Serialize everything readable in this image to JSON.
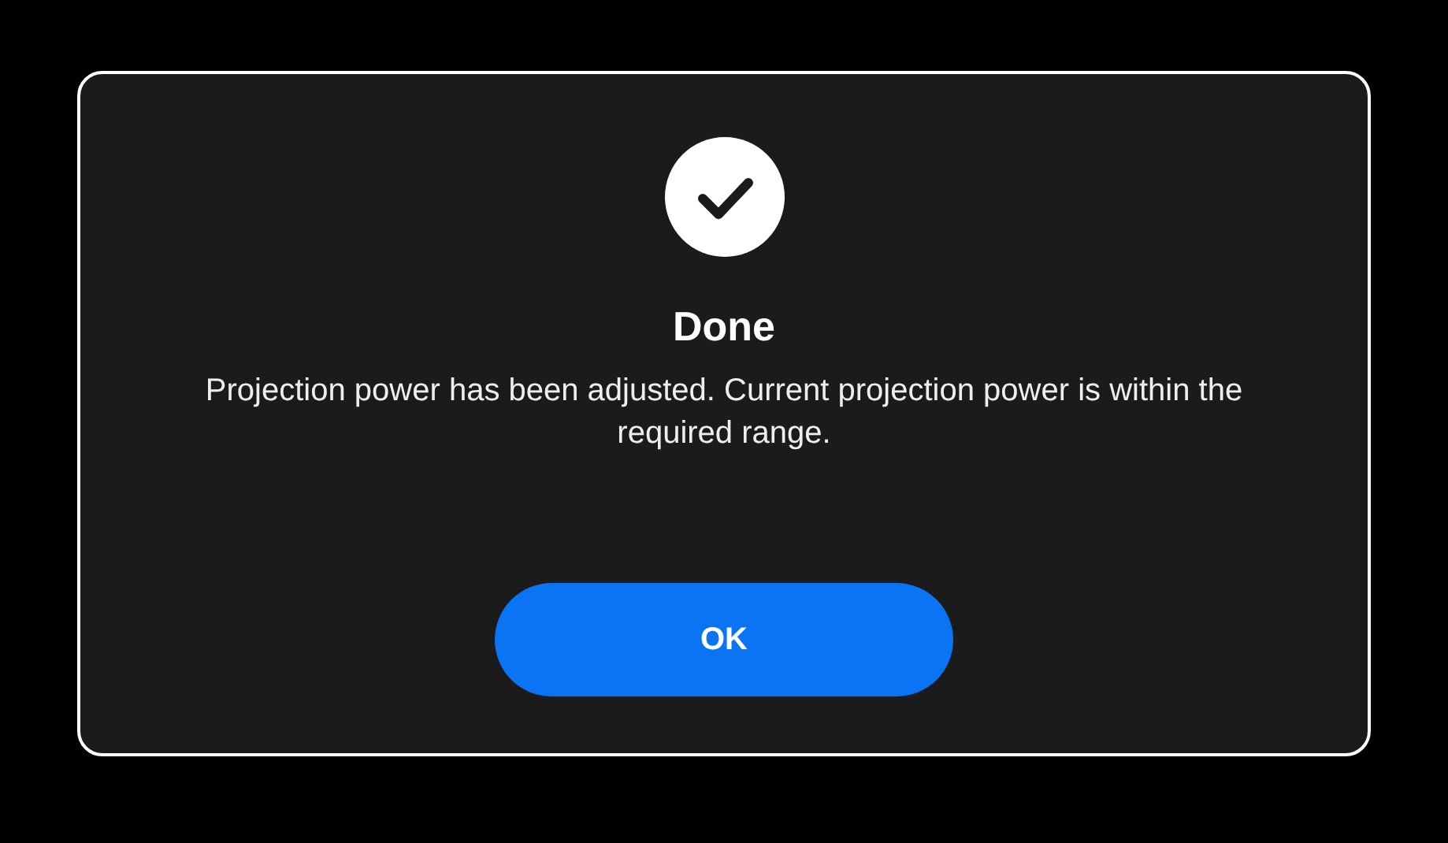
{
  "dialog": {
    "title": "Done",
    "message": "Projection power has been adjusted. Current projection power is within the required range.",
    "buttons": [
      {
        "label": "OK",
        "kind": "primary"
      }
    ]
  }
}
